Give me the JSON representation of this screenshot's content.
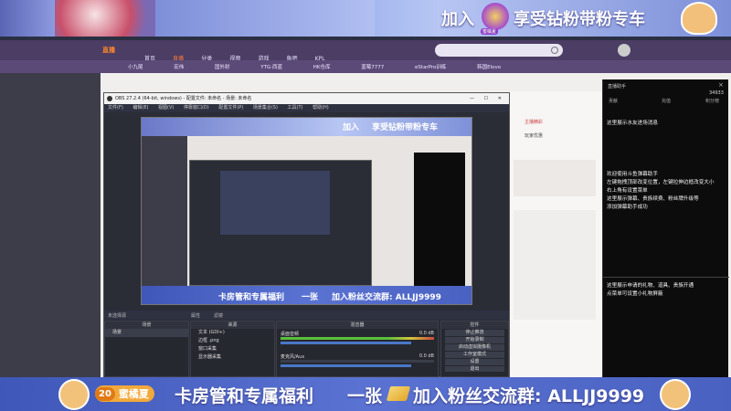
{
  "banner": {
    "join_text": "加入",
    "enjoy_text": "享受钻粉带粉专车",
    "badge_text": "蜜橘夏"
  },
  "site": {
    "logo": "直播",
    "nav": [
      "首页",
      "直播",
      "分类",
      "视频",
      "游戏",
      "鱼吧",
      "KPL"
    ],
    "search_placeholder": "",
    "category_tabs": [
      "小九尾",
      "宏伟",
      "国外射",
      "YTG·西蓝",
      "HK仓库",
      "蓝莓7777",
      "eStarPro训练",
      "韩国Elovo"
    ],
    "right_header": "直播助手",
    "right_cols": [
      "贡献",
      "充值",
      "积分榜"
    ],
    "chat_count": "34933",
    "right_notice": "主播精彩",
    "right_notice2": "玩家优惠"
  },
  "obs": {
    "title": "OBS 27.2.4 (64-bit, windows) - 配置文件: 未命名 - 场景: 未命名",
    "menu": [
      "文件(F)",
      "编辑(E)",
      "视图(V)",
      "停靠窗口(D)",
      "配置文件(P)",
      "场景集合(S)",
      "工具(T)",
      "帮助(H)"
    ],
    "no_source": "未选择源",
    "props": "属性",
    "filters": "滤镜",
    "scenes_header": "场景",
    "scene_item": "场景",
    "sources_header": "来源",
    "sources": [
      "文本 (GDI+)",
      "边框 .png",
      "窗口采集",
      "显示器采集"
    ],
    "mixer_header": "混音器",
    "mixer": [
      {
        "name": "桌面音频",
        "db": "0.0 dB"
      },
      {
        "name": "麦克风/Aux",
        "db": "0.0 dB"
      }
    ],
    "controls_header": "控件",
    "controls": [
      "停止推流",
      "开始录制",
      "启动虚拟摄像机",
      "工作室模式",
      "设置",
      "退出"
    ]
  },
  "chat": {
    "lines": [
      "这里展示水友进场消息",
      "",
      "欢迎使用斗鱼弹幕助手",
      "左键拖拽顶部改变位置，左键拉伸边框改变大小",
      "右上角有设置菜单",
      "这里展示弹幕、贵族续费、粉丝牌升级等",
      "添加弹幕助手成功"
    ],
    "gift_lines": [
      "这里展示申请的礼物、道具、贵族开通",
      "点菜单可设置小礼物屏蔽"
    ]
  },
  "bottom": {
    "level": "20",
    "name": "蜜橘夏",
    "title": "卡房管和专属福利",
    "one": "一张",
    "join": "加入粉丝交流群: ALLJJ9999"
  },
  "colors": {
    "accent": "#a061ff",
    "banner_blue": "#4961c1",
    "chat_bg": "#0c0c0c"
  }
}
